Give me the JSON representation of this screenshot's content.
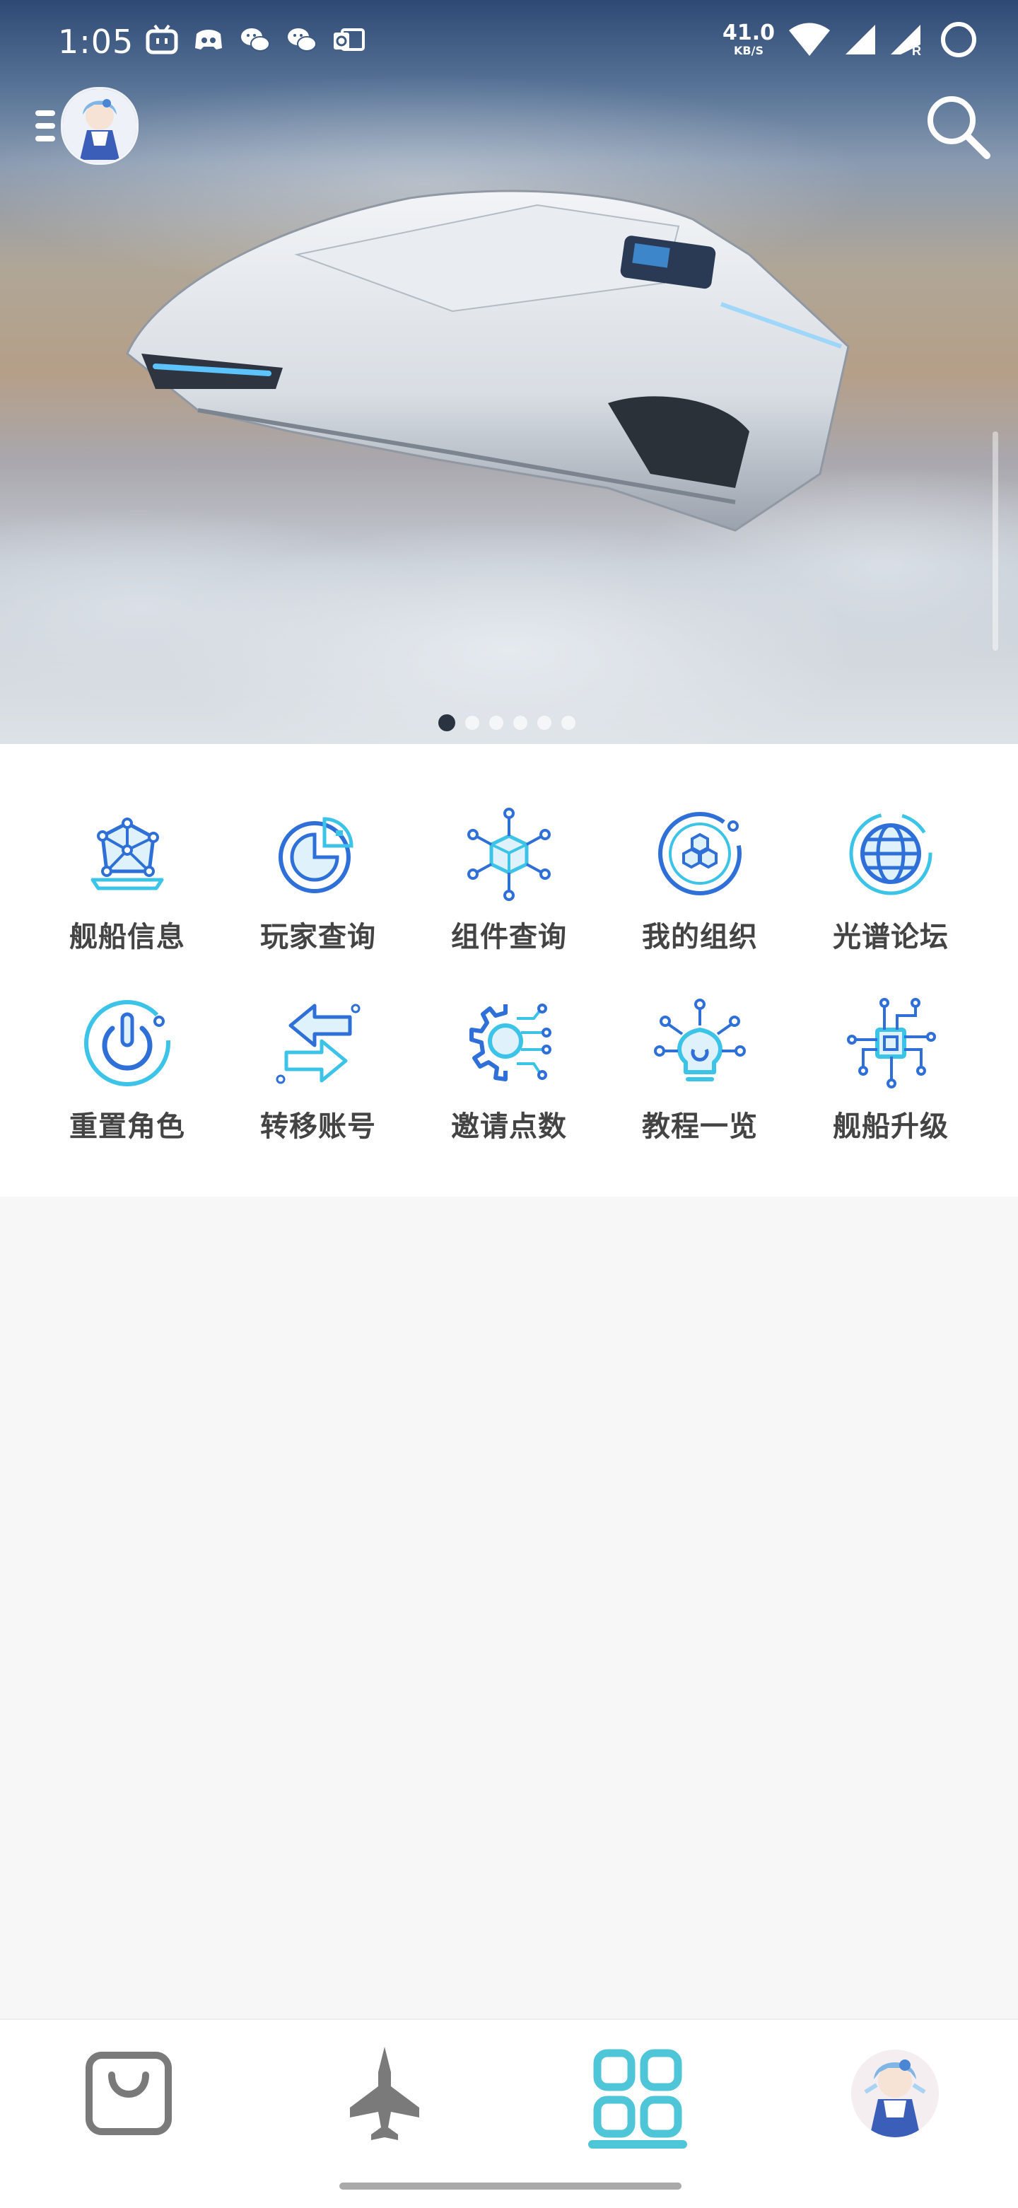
{
  "status_bar": {
    "time": "1:05",
    "net_speed_value": "41.0",
    "net_speed_unit": "KB/S",
    "app_icons": [
      "bilibili-icon",
      "discord-icon",
      "wechat-icon",
      "wechat-icon",
      "outlook-icon"
    ],
    "indicators": [
      "wifi-icon",
      "signal-icon",
      "signal-roaming-icon",
      "battery-ring-icon"
    ],
    "roaming_mark": "R"
  },
  "header": {
    "menu_icon": "menu-icon",
    "avatar": "user-avatar",
    "search_icon": "search-icon"
  },
  "banner": {
    "slide_count": 6,
    "active_slide": 0
  },
  "features": [
    {
      "label": "舰船信息",
      "icon": "ship-info-icon"
    },
    {
      "label": "玩家查询",
      "icon": "player-query-icon"
    },
    {
      "label": "组件查询",
      "icon": "component-query-icon"
    },
    {
      "label": "我的组织",
      "icon": "my-organization-icon"
    },
    {
      "label": "光谱论坛",
      "icon": "spectrum-forum-icon"
    },
    {
      "label": "重置角色",
      "icon": "reset-character-icon"
    },
    {
      "label": "转移账号",
      "icon": "transfer-account-icon"
    },
    {
      "label": "邀请点数",
      "icon": "invite-points-icon"
    },
    {
      "label": "教程一览",
      "icon": "tutorial-list-icon"
    },
    {
      "label": "舰船升级",
      "icon": "ship-upgrade-icon"
    }
  ],
  "bottom_nav": {
    "items": [
      "shop-bag-icon",
      "ship-icon",
      "apps-grid-icon",
      "profile-avatar"
    ],
    "active_index": 2
  },
  "colors": {
    "accent": "#4fc6d8",
    "icon_blue": "#2e6fd8",
    "icon_cyan": "#3bc3e8",
    "label": "#444444",
    "page_bg": "#f7f7f7"
  }
}
